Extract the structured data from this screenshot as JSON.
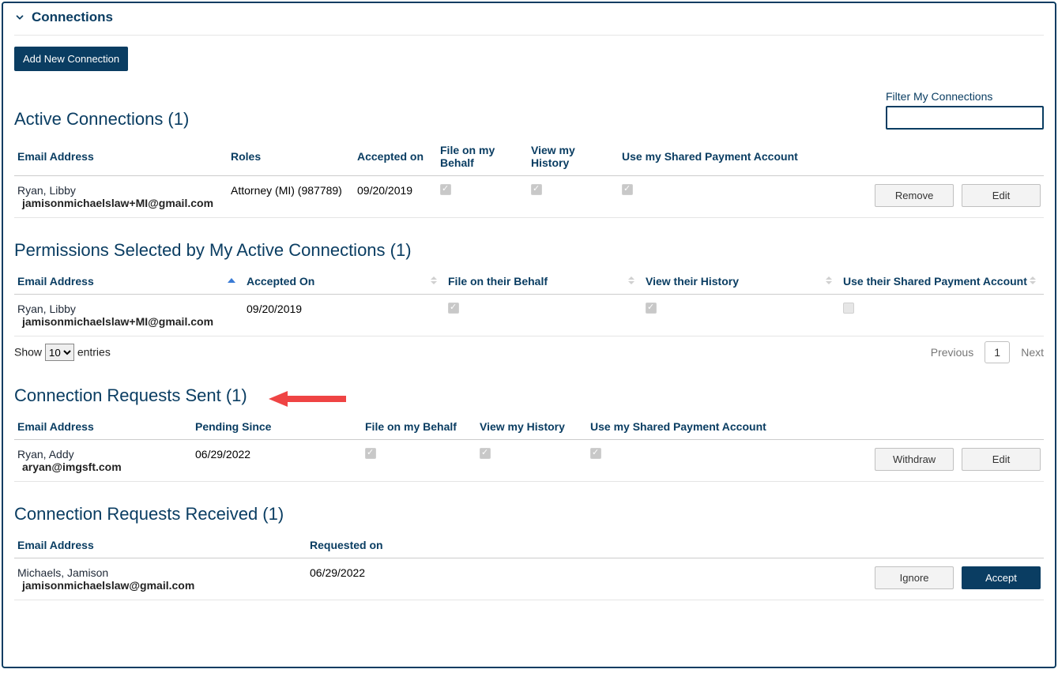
{
  "header": {
    "title": "Connections"
  },
  "addBtn": "Add New Connection",
  "filterLabel": "Filter My Connections",
  "active": {
    "title": "Active Connections (1)",
    "cols": {
      "email": "Email Address",
      "roles": "Roles",
      "accepted": "Accepted on",
      "fileBehalf": "File on my Behalf",
      "viewHist": "View my History",
      "sharedPay": "Use my Shared Payment Account"
    },
    "row": {
      "name": "Ryan, Libby",
      "email": "jamisonmichaelslaw+MI@gmail.com",
      "roles": "Attorney (MI) (987789)",
      "accepted": "09/20/2019"
    },
    "removeBtn": "Remove",
    "editBtn": "Edit"
  },
  "perms": {
    "title": "Permissions Selected by My Active Connections (1)",
    "cols": {
      "email": "Email Address",
      "accepted": "Accepted On",
      "fileBehalf": "File on their Behalf",
      "viewHist": "View their History",
      "sharedPay": "Use their Shared Payment Account"
    },
    "row": {
      "name": "Ryan, Libby",
      "email": "jamisonmichaelslaw+MI@gmail.com",
      "accepted": "09/20/2019"
    }
  },
  "pager": {
    "showLabel": "Show",
    "entriesLabel": "entries",
    "showValue": "10",
    "prev": "Previous",
    "page": "1",
    "next": "Next"
  },
  "sent": {
    "title": "Connection Requests Sent (1)",
    "cols": {
      "email": "Email Address",
      "pending": "Pending Since",
      "fileBehalf": "File on my Behalf",
      "viewHist": "View my History",
      "sharedPay": "Use my Shared Payment Account"
    },
    "row": {
      "name": "Ryan, Addy",
      "email": "aryan@imgsft.com",
      "pending": "06/29/2022"
    },
    "withdrawBtn": "Withdraw",
    "editBtn": "Edit"
  },
  "recv": {
    "title": "Connection Requests Received (1)",
    "cols": {
      "email": "Email Address",
      "requested": "Requested on"
    },
    "row": {
      "name": "Michaels, Jamison",
      "email": "jamisonmichaelslaw@gmail.com",
      "requested": "06/29/2022"
    },
    "ignoreBtn": "Ignore",
    "acceptBtn": "Accept"
  }
}
